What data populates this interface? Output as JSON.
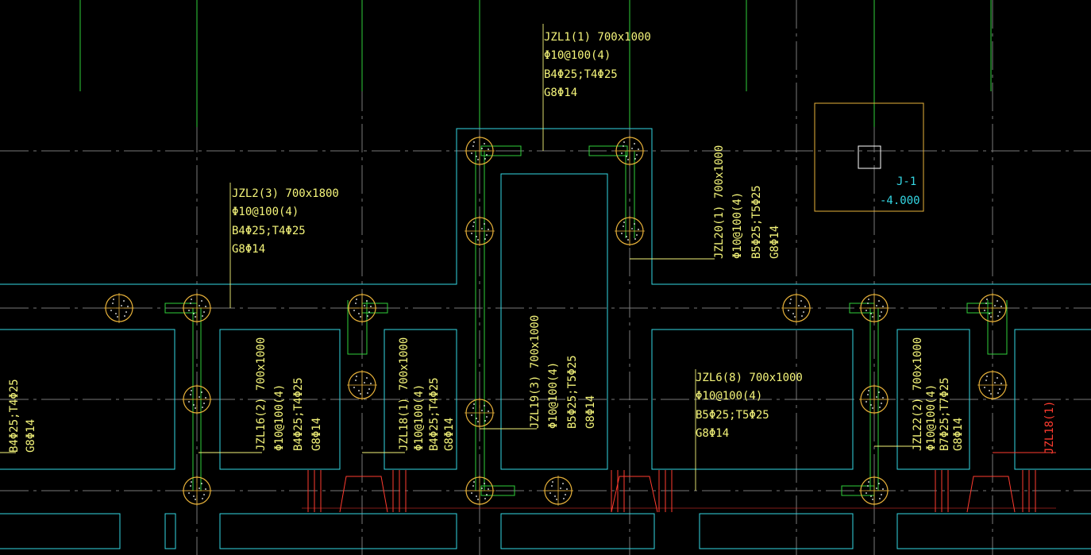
{
  "colors": {
    "background": "#000000",
    "axis_gray": "#7a7a7a",
    "axis_green": "#2fd13a",
    "outline_cyan": "#34d7e4",
    "label_yellow": "#f5f57a",
    "pile_orange": "#e8b23a",
    "section_red": "#ff3b2f",
    "footing_orange": "#e8b23a"
  },
  "beams": [
    {
      "id": "jzl1",
      "lines": [
        "JZL1(1) 700x1000",
        "Φ10@100(4)",
        "B4Φ25;T4Φ25",
        "G8Φ14"
      ]
    },
    {
      "id": "jzl2",
      "lines": [
        "JZL2(3) 700x1800",
        "Φ10@100(4)",
        "B4Φ25;T4Φ25",
        "G8Φ14"
      ]
    },
    {
      "id": "jzl6",
      "lines": [
        "JZL6(8) 700x1000",
        "Φ10@100(4)",
        "B5Φ25;T5Φ25",
        "G8Φ14"
      ]
    },
    {
      "id": "jzl20",
      "lines": [
        "JZL20(1) 700x1000",
        "Φ10@100(4)",
        "B5Φ25;T5Φ25",
        "G8Φ14"
      ]
    },
    {
      "id": "jzl16",
      "lines": [
        "JZL16(2) 700x1000",
        "Φ10@100(4)",
        "B4Φ25;T4Φ25",
        "G8Φ14"
      ]
    },
    {
      "id": "jzl18",
      "lines": [
        "JZL18(1) 700x1000",
        "Φ10@100(4)",
        "B4Φ25;T4Φ25",
        "G8Φ14"
      ]
    },
    {
      "id": "jzl19",
      "lines": [
        "JZL19(3) 700x1000",
        "Φ10@100(4)",
        "B5Φ25;T5Φ25",
        "G8Φ14"
      ]
    },
    {
      "id": "jzl22",
      "lines": [
        "JZL22(2) 700x1000",
        "Φ10@100(4)",
        "B7Φ25;T7Φ25",
        "G8Φ14"
      ]
    },
    {
      "id": "left_cut",
      "lines": [
        "B4Φ25;T4Φ25",
        "G8Φ14"
      ]
    }
  ],
  "footing": {
    "name": "J-1",
    "elevation": "-4.000"
  },
  "section_mark": "JZL18(1)"
}
